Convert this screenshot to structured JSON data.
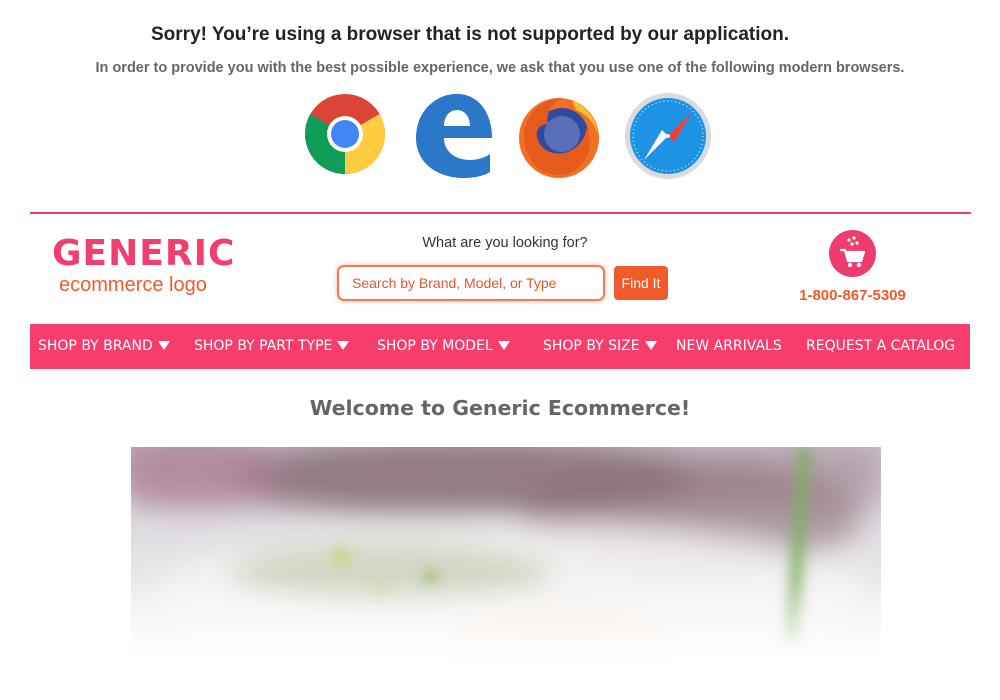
{
  "unsupported_notice": {
    "title": "Sorry! You’re using a browser that is not supported by our application.",
    "message": "In order to provide you with the best possible experience, we ask that you use one of the following modern browsers.",
    "browser_icons": [
      "chrome-icon",
      "edge-icon",
      "firefox-icon",
      "safari-icon"
    ]
  },
  "header": {
    "logo": {
      "main": "GENERIC",
      "sub": "ecommerce logo"
    },
    "search": {
      "label": "What are you looking for?",
      "placeholder": "Search by Brand, Model, or Type",
      "value": "",
      "button_label": "Find It"
    },
    "cart": {
      "icon": "cart-icon"
    },
    "phone": "1-800-867-5309"
  },
  "nav": {
    "items": [
      {
        "label": "SHOP BY BRAND",
        "dropdown": true
      },
      {
        "label": "SHOP BY PART TYPE",
        "dropdown": true
      },
      {
        "label": "SHOP BY MODEL",
        "dropdown": true
      },
      {
        "label": "SHOP BY SIZE",
        "dropdown": true
      },
      {
        "label": "NEW ARRIVALS",
        "dropdown": false
      },
      {
        "label": "REQUEST A CATALOG",
        "dropdown": false
      }
    ]
  },
  "main": {
    "welcome": "Welcome to Generic Ecommerce!"
  },
  "colors": {
    "brand_pink": "#f73c6e",
    "brand_orange": "#f15a29",
    "divider": "#e83b6b",
    "welcome_text": "#666666"
  }
}
